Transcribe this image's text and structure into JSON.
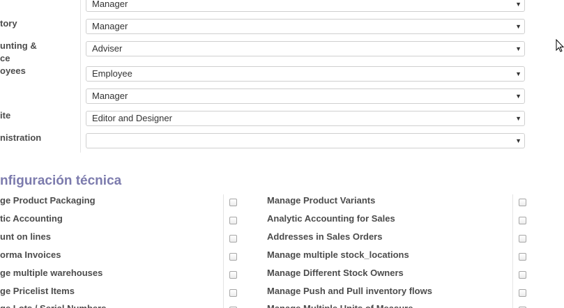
{
  "access_rights": [
    {
      "label": "",
      "value": "Manager"
    },
    {
      "label": "tory",
      "value": "Manager"
    },
    {
      "label": "unting &",
      "label2": "ce",
      "value": "Adviser"
    },
    {
      "label": "oyees",
      "value": "Employee"
    },
    {
      "label": "",
      "value": "Manager"
    },
    {
      "label": "ite",
      "value": "Editor and Designer"
    },
    {
      "label": "nistration",
      "value": ""
    }
  ],
  "technical": {
    "title": "nfiguración técnica",
    "left": [
      "ge Product Packaging",
      "tic Accounting",
      "unt on lines",
      "orma Invoices",
      "ge multiple warehouses",
      "ge Pricelist Items",
      "ge Lots / Serial Numbers"
    ],
    "right": [
      "Manage Product Variants",
      "Analytic Accounting for Sales",
      "Addresses in Sales Orders",
      "Manage multiple stock_locations",
      "Manage Different Stock Owners",
      "Manage Push and Pull inventory flows",
      "Manage Multiple Units of Measure"
    ]
  },
  "icons": {
    "caret": "caret-down-icon",
    "cursor": "mouse-cursor-icon"
  }
}
